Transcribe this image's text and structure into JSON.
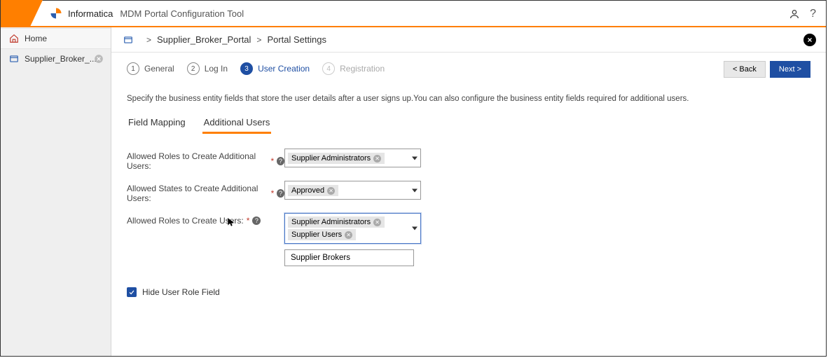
{
  "header": {
    "brand": "Informatica",
    "product": "MDM Portal Configuration Tool"
  },
  "sidebar": {
    "home_label": "Home",
    "portal_label": "Supplier_Broker_..."
  },
  "breadcrumb": {
    "item1": "Supplier_Broker_Portal",
    "item2": "Portal Settings"
  },
  "wizard": {
    "steps": [
      {
        "num": "1",
        "label": "General"
      },
      {
        "num": "2",
        "label": "Log In"
      },
      {
        "num": "3",
        "label": "User Creation"
      },
      {
        "num": "4",
        "label": "Registration"
      }
    ],
    "back_label": "< Back",
    "next_label": "Next >"
  },
  "description": "Specify the business entity fields that store the user details after a user signs up.You can also configure the business entity fields required for additional users.",
  "tabs": {
    "field_mapping": "Field Mapping",
    "additional_users": "Additional Users"
  },
  "form": {
    "row1_label": "Allowed Roles to Create Additional Users:",
    "row1_chips": [
      "Supplier Administrators"
    ],
    "row2_label": "Allowed States to Create Additional Users:",
    "row2_chips": [
      "Approved"
    ],
    "row3_label": "Allowed Roles to Create Users:",
    "row3_chips": [
      "Supplier Administrators",
      "Supplier Users"
    ],
    "row3_dropdown": [
      "Supplier Brokers"
    ],
    "hide_label": "Hide User Role Field"
  }
}
